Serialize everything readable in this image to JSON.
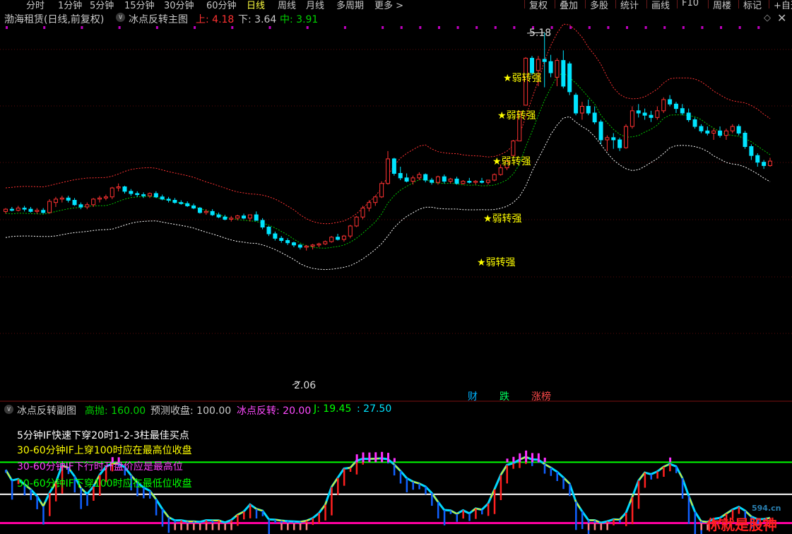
{
  "periods": [
    "分时",
    "1分钟",
    "5分钟",
    "15分钟",
    "30分钟",
    "60分钟",
    "日线",
    "周线",
    "月线",
    "多周期",
    "更多 >"
  ],
  "active_period": "日线",
  "toolbar": [
    "复权",
    "叠加",
    "多股",
    "统计",
    "画线",
    "F10",
    "周楼",
    "标记",
    "+自选"
  ],
  "stock_title": "渤海租赁(日线,前复权)",
  "indicator": {
    "name": "冰点反转主图",
    "upper_label": "上: 4.18",
    "lower_label": "下: 3.64",
    "mid_label": "中: 3.91"
  },
  "price_high": "5.18",
  "price_low": "2.06",
  "star_label": "弱转强",
  "tags": {
    "cai": "财",
    "die": "跌",
    "zhang": "涨榜"
  },
  "sub": {
    "name": "冰点反转副图",
    "gaopao": "高抛: 160.00",
    "yuce": "预测收盘: 100.00",
    "bingdian": "冰点反转: 20.00",
    "j": "J: 19.45",
    "last": ": 27.50"
  },
  "notes": [
    "5分钟IF快速下穿20时1-2-3柱最佳买点",
    "30-60分钟IF上穿100时应在最高位收盘",
    "30-60分钟IF下行时开盘价应是最高位",
    "30-60分钟IF下穿100时应在最低位收盘"
  ],
  "watermark": {
    "url": "594.cn",
    "text": "你就是股神"
  },
  "colors": {
    "up": "#ff3232",
    "down": "#00e4ff",
    "upper_band": "#ff3232",
    "mid_band": "#00c800",
    "lower_band": "#ffffff",
    "green_line": "#00ff00",
    "white_line": "#ffffff",
    "magenta_line": "#ff00a0"
  },
  "candles": [
    [
      3.58,
      3.61,
      3.56,
      3.6
    ],
    [
      3.6,
      3.62,
      3.58,
      3.59
    ],
    [
      3.59,
      3.63,
      3.58,
      3.61
    ],
    [
      3.61,
      3.63,
      3.58,
      3.6
    ],
    [
      3.6,
      3.62,
      3.57,
      3.58
    ],
    [
      3.58,
      3.61,
      3.56,
      3.59
    ],
    [
      3.59,
      3.61,
      3.56,
      3.57
    ],
    [
      3.57,
      3.69,
      3.56,
      3.67
    ],
    [
      3.66,
      3.71,
      3.62,
      3.69
    ],
    [
      3.69,
      3.72,
      3.66,
      3.7
    ],
    [
      3.7,
      3.72,
      3.66,
      3.68
    ],
    [
      3.68,
      3.7,
      3.63,
      3.64
    ],
    [
      3.64,
      3.66,
      3.6,
      3.62
    ],
    [
      3.62,
      3.66,
      3.6,
      3.64
    ],
    [
      3.64,
      3.7,
      3.62,
      3.69
    ],
    [
      3.69,
      3.72,
      3.66,
      3.7
    ],
    [
      3.7,
      3.73,
      3.68,
      3.71
    ],
    [
      3.71,
      3.8,
      3.69,
      3.79
    ],
    [
      3.79,
      3.83,
      3.76,
      3.8
    ],
    [
      3.8,
      3.81,
      3.74,
      3.76
    ],
    [
      3.76,
      3.78,
      3.72,
      3.74
    ],
    [
      3.74,
      3.76,
      3.71,
      3.73
    ],
    [
      3.73,
      3.75,
      3.7,
      3.72
    ],
    [
      3.72,
      3.75,
      3.7,
      3.74
    ],
    [
      3.74,
      3.76,
      3.7,
      3.71
    ],
    [
      3.71,
      3.73,
      3.68,
      3.69
    ],
    [
      3.69,
      3.71,
      3.66,
      3.68
    ],
    [
      3.68,
      3.7,
      3.65,
      3.66
    ],
    [
      3.66,
      3.68,
      3.64,
      3.65
    ],
    [
      3.65,
      3.67,
      3.62,
      3.63
    ],
    [
      3.63,
      3.65,
      3.6,
      3.61
    ],
    [
      3.61,
      3.62,
      3.56,
      3.57
    ],
    [
      3.57,
      3.6,
      3.55,
      3.58
    ],
    [
      3.58,
      3.6,
      3.54,
      3.55
    ],
    [
      3.55,
      3.57,
      3.52,
      3.53
    ],
    [
      3.53,
      3.55,
      3.5,
      3.51
    ],
    [
      3.51,
      3.54,
      3.49,
      3.52
    ],
    [
      3.52,
      3.55,
      3.5,
      3.54
    ],
    [
      3.54,
      3.56,
      3.51,
      3.52
    ],
    [
      3.52,
      3.54,
      3.49,
      3.55
    ],
    [
      3.55,
      3.58,
      3.52,
      3.5
    ],
    [
      3.5,
      3.52,
      3.42,
      3.44
    ],
    [
      3.44,
      3.45,
      3.36,
      3.38
    ],
    [
      3.38,
      3.4,
      3.32,
      3.34
    ],
    [
      3.34,
      3.36,
      3.3,
      3.32
    ],
    [
      3.32,
      3.34,
      3.28,
      3.3
    ],
    [
      3.3,
      3.31,
      3.26,
      3.28
    ],
    [
      3.28,
      3.29,
      3.24,
      3.26
    ],
    [
      3.26,
      3.28,
      3.23,
      3.27
    ],
    [
      3.27,
      3.29,
      3.24,
      3.28
    ],
    [
      3.28,
      3.3,
      3.26,
      3.29
    ],
    [
      3.29,
      3.32,
      3.28,
      3.31
    ],
    [
      3.31,
      3.36,
      3.3,
      3.35
    ],
    [
      3.35,
      3.38,
      3.32,
      3.33
    ],
    [
      3.33,
      3.37,
      3.31,
      3.36
    ],
    [
      3.36,
      3.46,
      3.34,
      3.45
    ],
    [
      3.45,
      3.54,
      3.44,
      3.53
    ],
    [
      3.53,
      3.63,
      3.51,
      3.61
    ],
    [
      3.61,
      3.68,
      3.58,
      3.66
    ],
    [
      3.66,
      3.72,
      3.63,
      3.71
    ],
    [
      3.71,
      3.85,
      3.7,
      3.83
    ],
    [
      3.83,
      4.12,
      3.82,
      4.05
    ],
    [
      4.05,
      4.06,
      3.9,
      3.92
    ],
    [
      3.92,
      3.98,
      3.86,
      3.88
    ],
    [
      3.88,
      3.92,
      3.84,
      3.85
    ],
    [
      3.85,
      3.9,
      3.82,
      3.88
    ],
    [
      3.88,
      3.93,
      3.86,
      3.91
    ],
    [
      3.91,
      3.92,
      3.84,
      3.86
    ],
    [
      3.86,
      3.88,
      3.82,
      3.84
    ],
    [
      3.84,
      3.9,
      3.82,
      3.89
    ],
    [
      3.89,
      3.91,
      3.83,
      3.85
    ],
    [
      3.85,
      3.88,
      3.83,
      3.87
    ],
    [
      3.87,
      3.89,
      3.82,
      3.83
    ],
    [
      3.83,
      3.86,
      3.82,
      3.85
    ],
    [
      3.85,
      3.88,
      3.83,
      3.84
    ],
    [
      3.84,
      3.86,
      3.82,
      3.85
    ],
    [
      3.85,
      3.88,
      3.83,
      3.84
    ],
    [
      3.84,
      3.86,
      3.82,
      3.86
    ],
    [
      3.86,
      3.92,
      3.85,
      3.91
    ],
    [
      3.91,
      4.0,
      3.9,
      3.97
    ],
    [
      3.97,
      4.06,
      3.95,
      4.03
    ],
    [
      4.08,
      4.22,
      4.08,
      4.21
    ],
    [
      4.21,
      4.48,
      4.21,
      4.47
    ],
    [
      4.53,
      4.96,
      4.53,
      4.95
    ],
    [
      4.95,
      4.97,
      4.8,
      4.82
    ],
    [
      4.84,
      4.97,
      4.7,
      4.94
    ],
    [
      4.94,
      5.18,
      4.69,
      4.92
    ],
    [
      4.92,
      4.98,
      4.78,
      4.82
    ],
    [
      4.78,
      4.95,
      4.7,
      4.93
    ],
    [
      4.93,
      5.02,
      4.68,
      4.7
    ],
    [
      4.9,
      4.92,
      4.62,
      4.65
    ],
    [
      4.62,
      4.64,
      4.44,
      4.46
    ],
    [
      4.46,
      4.56,
      4.4,
      4.52
    ],
    [
      4.52,
      4.58,
      4.44,
      4.46
    ],
    [
      4.46,
      4.52,
      4.36,
      4.38
    ],
    [
      4.38,
      4.4,
      4.18,
      4.22
    ],
    [
      4.22,
      4.26,
      4.12,
      4.24
    ],
    [
      4.24,
      4.28,
      4.14,
      4.22
    ],
    [
      4.22,
      4.24,
      4.12,
      4.15
    ],
    [
      4.15,
      4.36,
      4.14,
      4.34
    ],
    [
      4.34,
      4.52,
      4.32,
      4.48
    ],
    [
      4.48,
      4.54,
      4.42,
      4.46
    ],
    [
      4.46,
      4.5,
      4.4,
      4.44
    ],
    [
      4.44,
      4.48,
      4.38,
      4.42
    ],
    [
      4.42,
      4.52,
      4.4,
      4.48
    ],
    [
      4.48,
      4.6,
      4.46,
      4.58
    ],
    [
      4.58,
      4.62,
      4.52,
      4.54
    ],
    [
      4.54,
      4.56,
      4.46,
      4.5
    ],
    [
      4.5,
      4.54,
      4.44,
      4.46
    ],
    [
      4.46,
      4.5,
      4.38,
      4.4
    ],
    [
      4.4,
      4.42,
      4.32,
      4.34
    ],
    [
      4.34,
      4.36,
      4.28,
      4.3
    ],
    [
      4.3,
      4.34,
      4.26,
      4.28
    ],
    [
      4.28,
      4.32,
      4.22,
      4.3
    ],
    [
      4.3,
      4.34,
      4.24,
      4.26
    ],
    [
      4.26,
      4.32,
      4.22,
      4.3
    ],
    [
      4.3,
      4.36,
      4.28,
      4.34
    ],
    [
      4.34,
      4.36,
      4.26,
      4.28
    ],
    [
      4.28,
      4.3,
      4.14,
      4.16
    ],
    [
      4.16,
      4.18,
      4.04,
      4.08
    ],
    [
      4.08,
      4.1,
      3.98,
      4.02
    ],
    [
      4.02,
      4.04,
      3.96,
      3.99
    ],
    [
      3.99,
      4.06,
      3.98,
      4.03
    ]
  ]
}
